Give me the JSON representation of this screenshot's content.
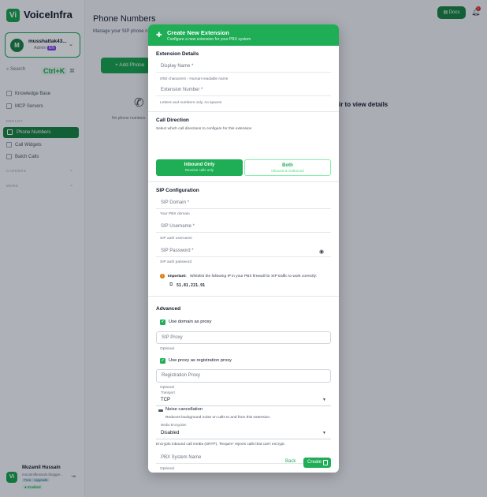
{
  "app": {
    "brand": "VoiceInfra",
    "logo_text": "Vi",
    "account": {
      "name": "musshattak43...",
      "role": "Admin",
      "badge": "EN",
      "avatar": "M"
    },
    "search": {
      "label": "Search",
      "shortcut": "Ctrl+K"
    },
    "nav_top": [
      {
        "label": "Knowledge Base"
      },
      {
        "label": "MCP Servers"
      }
    ],
    "section_deploy": "DEPLOY",
    "nav_deploy": [
      {
        "label": "Phone Numbers"
      },
      {
        "label": "Call Widgets"
      },
      {
        "label": "Batch Calls"
      }
    ],
    "section_careers": "CAREERS",
    "section_more": "MORE",
    "user": {
      "name": "Muzamil Hussain",
      "email": "muzamilhussain.blogger...",
      "plan": "Free · Upgrade",
      "status": "Enabled",
      "avatar": "Vi"
    },
    "docs_label": "Docs",
    "notif_count": "2"
  },
  "page": {
    "title": "Phone Numbers",
    "subtitle": "Manage your SIP phone numbers",
    "add_button": "+ Add Phone",
    "empty_text": "No phone numbers",
    "view_details": "ir to view details"
  },
  "modal": {
    "title": "Create New Extension",
    "subtitle": "Configure a new extension for your PBX system",
    "extension_details": {
      "heading": "Extension Details",
      "display_name_label": "Display Name *",
      "display_name_help": "0/50 characters - Human-readable name",
      "ext_number_label": "Extension Number *",
      "ext_number_help": "Letters and numbers only, no spaces"
    },
    "call_direction": {
      "heading": "Call Direction",
      "desc": "Select which call directions to configure for this extension",
      "inbound_label": "Inbound Only",
      "inbound_sub": "Receive calls only",
      "both_label": "Both",
      "both_sub": "Inbound & Outbound"
    },
    "sip": {
      "heading": "SIP Configuration",
      "domain_label": "SIP Domain *",
      "domain_help": "Your PBX domain",
      "username_label": "SIP Username *",
      "username_help": "SIP auth username",
      "password_label": "SIP Password *",
      "password_help": "SIP auth password",
      "important_label": "Important:",
      "important_text": "Whitelist the following IP in your PBX firewall for SIP traffic to work correctly:",
      "whitelist_ip": "51.81.221.91"
    },
    "advanced": {
      "heading": "Advanced",
      "use_domain_proxy": "Use domain as proxy",
      "sip_proxy_placeholder": "SIP Proxy",
      "sip_proxy_help": "Optional",
      "use_proxy_registration": "Use proxy as registration proxy",
      "registration_proxy_placeholder": "Registration Proxy",
      "registration_proxy_help": "Optional",
      "transport_label": "Transport",
      "transport_value": "TCP",
      "noise_label": "Noise cancellation",
      "noise_desc": "Reduces background noise on calls to and from this extension.",
      "media_label": "Media Encryption",
      "media_value": "Disabled",
      "media_desc": "Encrypts inbound call media (SRTP). 'Require' rejects calls that can't encrypt.",
      "pbx_name_label": "PBX System Name",
      "pbx_name_help": "Optional"
    },
    "footer": {
      "back": "Back",
      "create": "Create"
    }
  },
  "colors": {
    "accent": "#1fad56",
    "sidebar_active": "#15803d",
    "warning": "#d97706"
  }
}
